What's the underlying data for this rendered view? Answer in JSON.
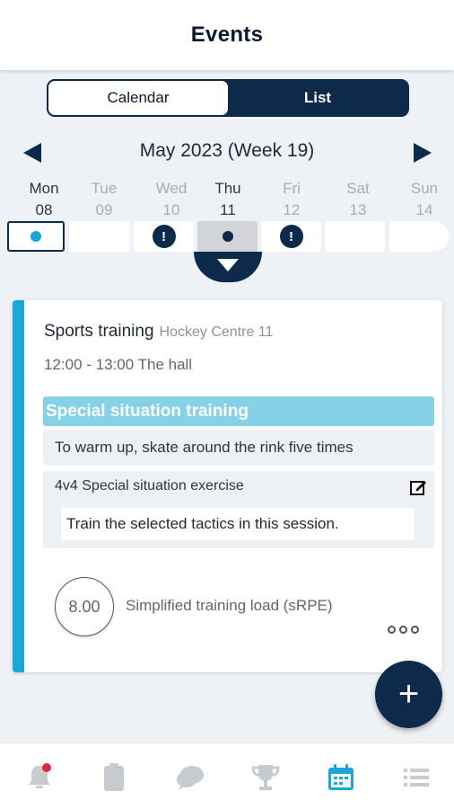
{
  "header": {
    "title": "Events"
  },
  "view_toggle": {
    "calendar_label": "Calendar",
    "list_label": "List",
    "active": "Calendar"
  },
  "week": {
    "label": "May 2023 (Week 19)"
  },
  "days": [
    {
      "name": "Mon",
      "num": "08"
    },
    {
      "name": "Tue",
      "num": "09"
    },
    {
      "name": "Wed",
      "num": "10"
    },
    {
      "name": "Thu",
      "num": "11"
    },
    {
      "name": "Fri",
      "num": "12"
    },
    {
      "name": "Sat",
      "num": "13"
    },
    {
      "name": "Sun",
      "num": "14"
    }
  ],
  "day_markers": {
    "alert": "!"
  },
  "event": {
    "title": "Sports training",
    "location": "Hockey Centre 11",
    "time": "12:00 - 13:00 The hall",
    "section": "Special situation training",
    "exercise1": "To warm up, skate around the rink five times",
    "exercise2_title": "4v4 Special situation exercise",
    "exercise2_desc": "Train the selected tactics in this session.",
    "load_value": "8.00",
    "load_label": "Simplified training load (sRPE)"
  },
  "fab": {
    "label": "+"
  },
  "colors": {
    "navy": "#0d2a4a",
    "accent": "#1aa6d6",
    "section_bg": "#85d1e8",
    "notify": "#e0283a"
  },
  "nav": [
    {
      "icon": "bell-icon",
      "badge": true,
      "active": false
    },
    {
      "icon": "clipboard-icon",
      "active": false
    },
    {
      "icon": "chat-icon",
      "active": false
    },
    {
      "icon": "trophy-icon",
      "active": false
    },
    {
      "icon": "calendar-icon",
      "active": true
    },
    {
      "icon": "list-icon",
      "active": false
    }
  ]
}
